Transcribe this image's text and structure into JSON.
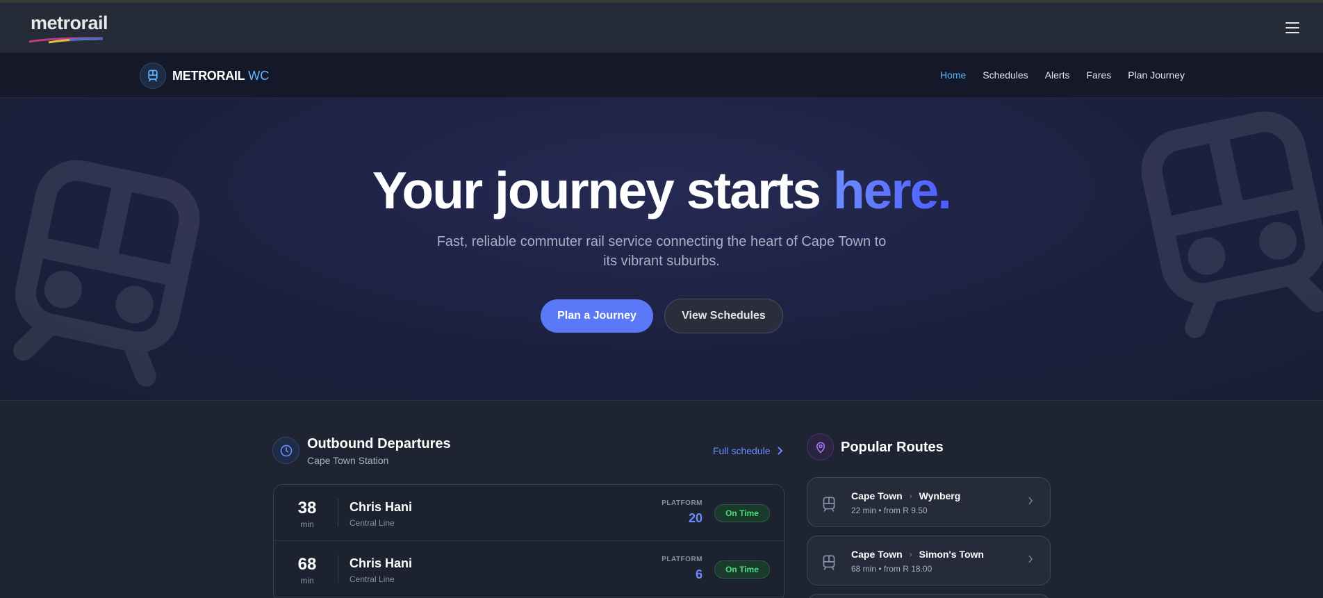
{
  "topbar": {
    "logo_text": "metrorail"
  },
  "nav": {
    "brand": "METRORAIL",
    "brand_suffix": "WC",
    "links": [
      "Home",
      "Schedules",
      "Alerts",
      "Fares",
      "Plan Journey"
    ],
    "active": "Home"
  },
  "hero": {
    "title": "Your journey starts ",
    "title_accent": "here.",
    "subtitle": "Fast, reliable commuter rail service connecting the heart of Cape Town to its vibrant suburbs.",
    "primary_button": "Plan a Journey",
    "secondary_button": "View Schedules"
  },
  "departures": {
    "title": "Outbound Departures",
    "station": "Cape Town Station",
    "full_schedule": "Full schedule",
    "platform_label": "PLATFORM",
    "min_label": "min",
    "rows": [
      {
        "mins": "38",
        "destination": "Chris Hani",
        "line": "Central Line",
        "platform": "20",
        "status": "On Time"
      },
      {
        "mins": "68",
        "destination": "Chris Hani",
        "line": "Central Line",
        "platform": "6",
        "status": "On Time"
      }
    ]
  },
  "routes": {
    "title": "Popular Routes",
    "items": [
      {
        "from": "Cape Town",
        "to": "Wynberg",
        "meta": "22 min • from R 9.50"
      },
      {
        "from": "Cape Town",
        "to": "Simon's Town",
        "meta": "68 min • from R 18.00"
      }
    ]
  },
  "colors": {
    "accent": "#5b78f6",
    "link": "#5fb7ff",
    "on_time": "#4ade80"
  }
}
